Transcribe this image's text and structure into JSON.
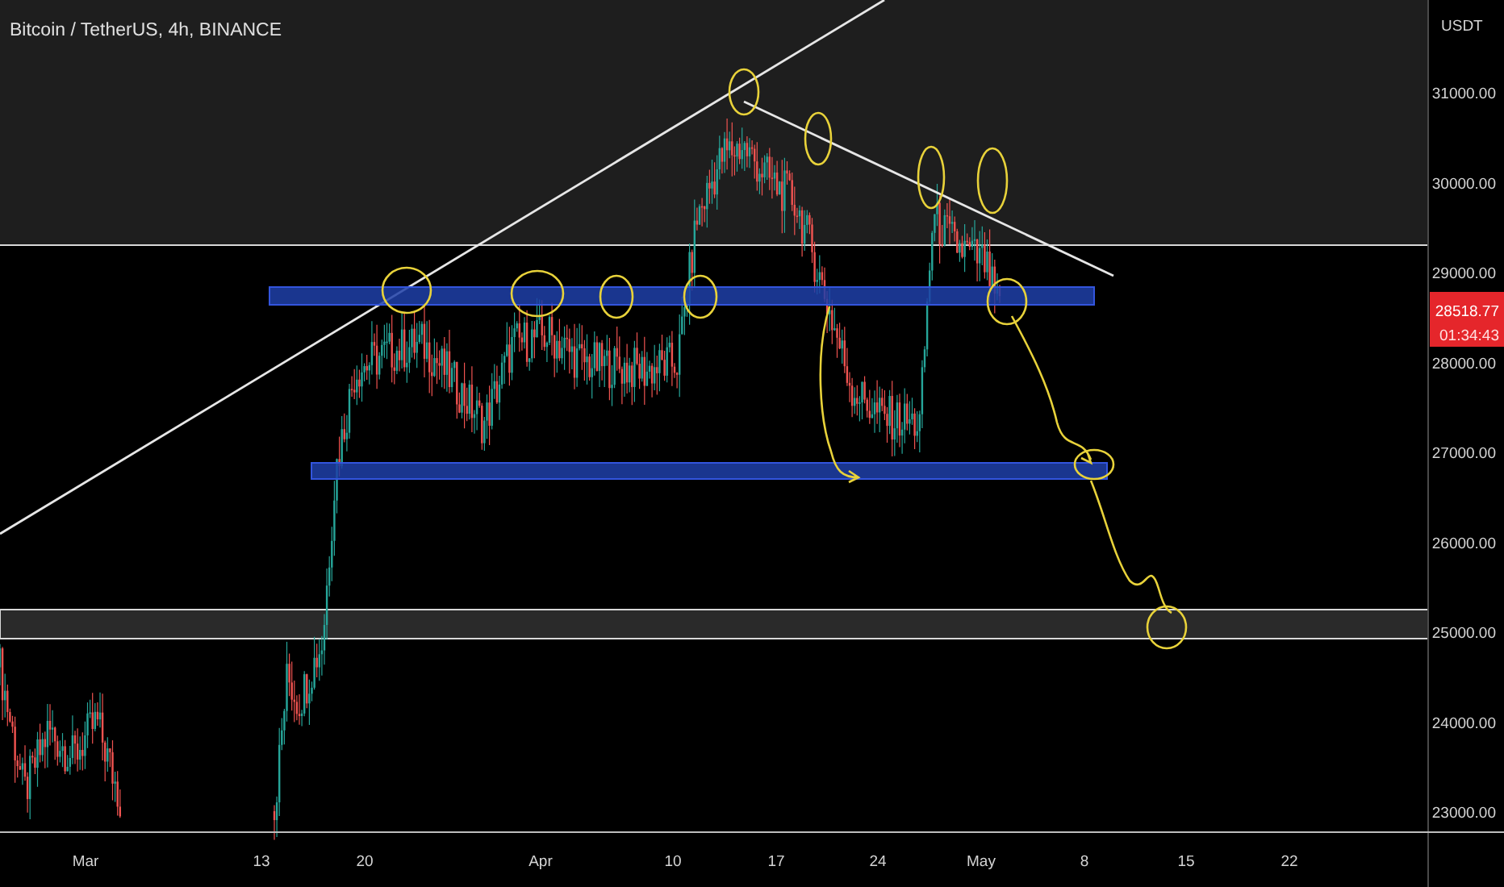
{
  "title": "Bitcoin / TetherUS, 4h, BINANCE",
  "price_axis": {
    "currency": "USDT",
    "labels": [
      "31000.00",
      "30000.00",
      "29000.00",
      "28000.00",
      "27000.00",
      "26000.00",
      "25000.00",
      "24000.00",
      "23000.00"
    ]
  },
  "time_axis": {
    "labels": [
      "Mar",
      "13",
      "20",
      "Apr",
      "10",
      "17",
      "24",
      "May",
      "8",
      "15",
      "22"
    ]
  },
  "last_price": {
    "price": "28518.77",
    "countdown": "01:34:43"
  }
}
